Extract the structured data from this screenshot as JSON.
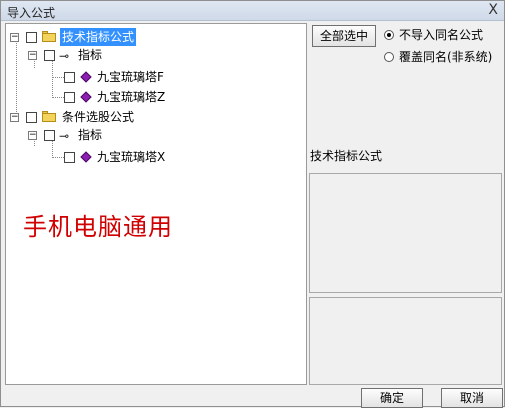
{
  "dialog": {
    "title": "导入公式",
    "close_glyph": "X"
  },
  "tree": {
    "nodes": [
      {
        "label": "技术指标公式",
        "icon": "folder-icon"
      },
      {
        "label": "指标",
        "icon": "key-icon"
      },
      {
        "label": "九宝琉璃塔F",
        "icon": "gem-icon"
      },
      {
        "label": "九宝琉璃塔Z",
        "icon": "gem-icon"
      },
      {
        "label": "条件选股公式",
        "icon": "folder-icon"
      },
      {
        "label": "指标",
        "icon": "key-icon"
      },
      {
        "label": "九宝琉璃塔X",
        "icon": "gem-icon"
      }
    ],
    "expander_glyph": "−"
  },
  "overlay_text": "手机电脑通用",
  "select_all_label": "全部选中",
  "options": [
    {
      "label": "不导入同名公式",
      "selected": true
    },
    {
      "label": "覆盖同名(非系统)",
      "selected": false
    }
  ],
  "info_label": "技术指标公式",
  "ok_label": "确定",
  "cancel_label": "取消",
  "colors": {
    "overlay_text": "#d10000",
    "selection": "#3390ff",
    "gem": "#8a1fb0",
    "folder": "#f2d35c"
  }
}
